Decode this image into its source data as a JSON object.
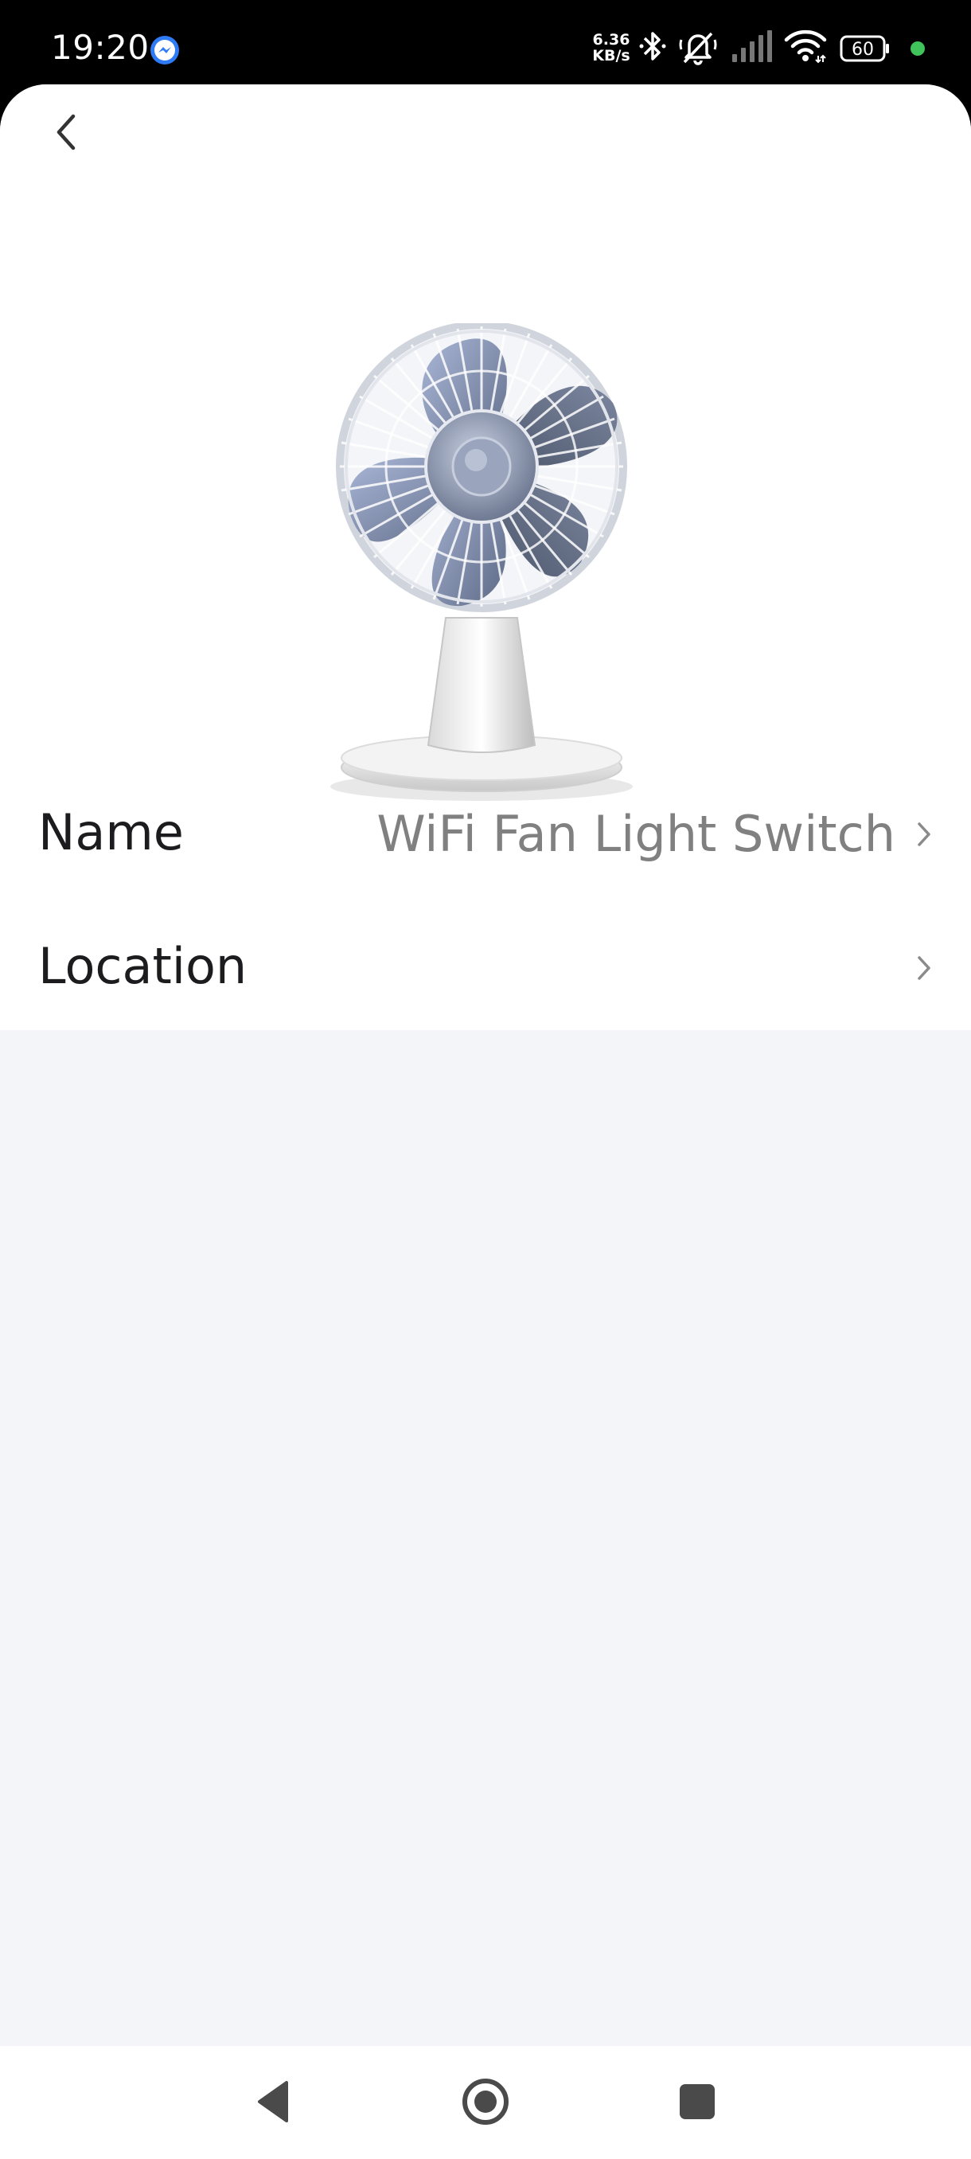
{
  "status_bar": {
    "time": "19:20",
    "net_speed_value": "6.36",
    "net_speed_unit": "KB/s",
    "battery_level": "60",
    "icons": [
      "messenger-icon",
      "bluetooth-icon",
      "muted-bell-icon",
      "signal-icon",
      "wifi-icon",
      "battery-icon",
      "privacy-indicator-dot"
    ]
  },
  "header": {
    "back_icon": "chevron-left-icon"
  },
  "device": {
    "image_icon": "desk-fan-icon"
  },
  "settings": {
    "rows": [
      {
        "label": "Name",
        "value": "WiFi Fan Light Switch",
        "chevron": "chevron-right-icon"
      },
      {
        "label": "Location",
        "value": "",
        "chevron": "chevron-right-icon"
      }
    ]
  },
  "nav_bar": {
    "buttons": [
      "back-triangle-icon",
      "home-circle-icon",
      "recents-square-icon"
    ]
  },
  "colors": {
    "page_background": "#f4f5f9",
    "sheet_background": "#ffffff",
    "label_text": "#1c1c1e",
    "value_text": "#808080",
    "status_dot": "#3fc35a"
  }
}
